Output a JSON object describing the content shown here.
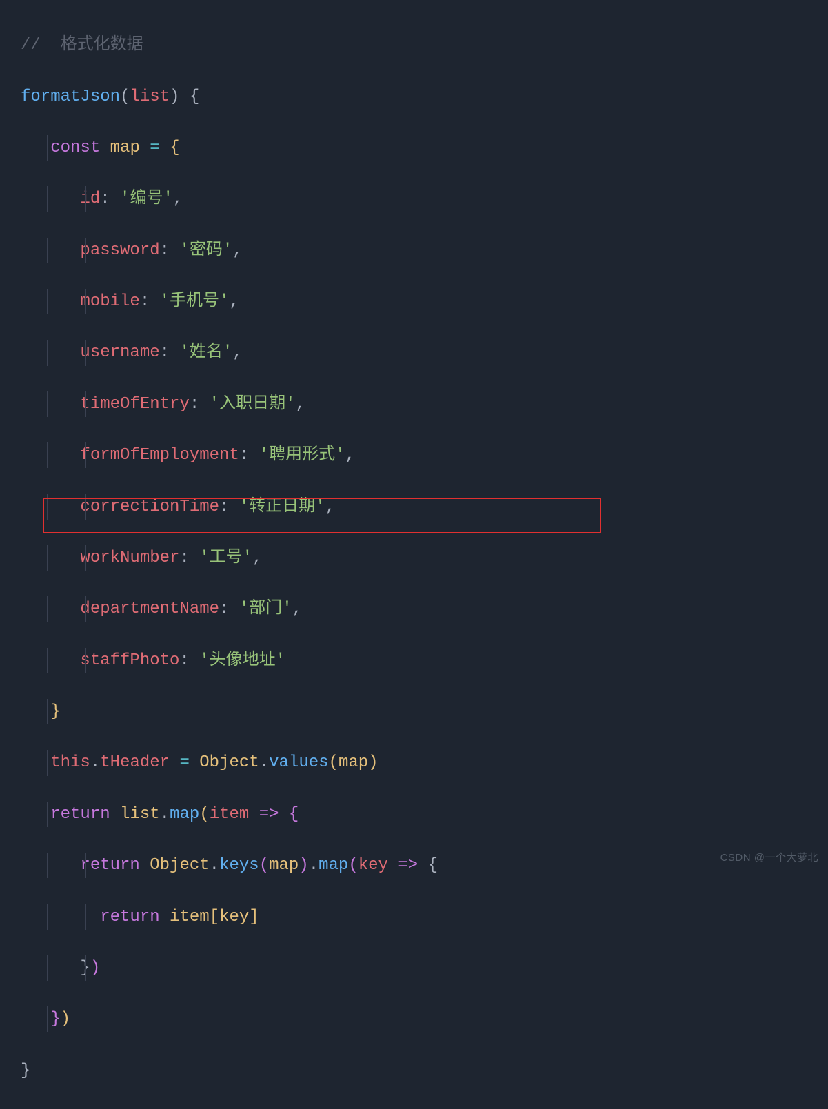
{
  "comment": "//  格式化数据",
  "func_name": "formatJson",
  "func_param": "list",
  "kw_const": "const",
  "var_map": "map",
  "map_entries": {
    "id": "'编号'",
    "password": "'密码'",
    "mobile": "'手机号'",
    "username": "'姓名'",
    "timeOfEntry": "'入职日期'",
    "formOfEmployment": "'聘用形式'",
    "correctionTime": "'转正日期'",
    "workNumber": "'工号'",
    "departmentName": "'部门'",
    "staffPhoto": "'头像地址'"
  },
  "this_kw": "this",
  "tHeader": "tHeader",
  "object_name": "Object",
  "values_method": "values",
  "keys_method": "keys",
  "map_method": "map",
  "return_kw": "return",
  "list_var": "list",
  "item_param": "item",
  "key_param": "key",
  "watermark": "CSDN @一个大萝北"
}
